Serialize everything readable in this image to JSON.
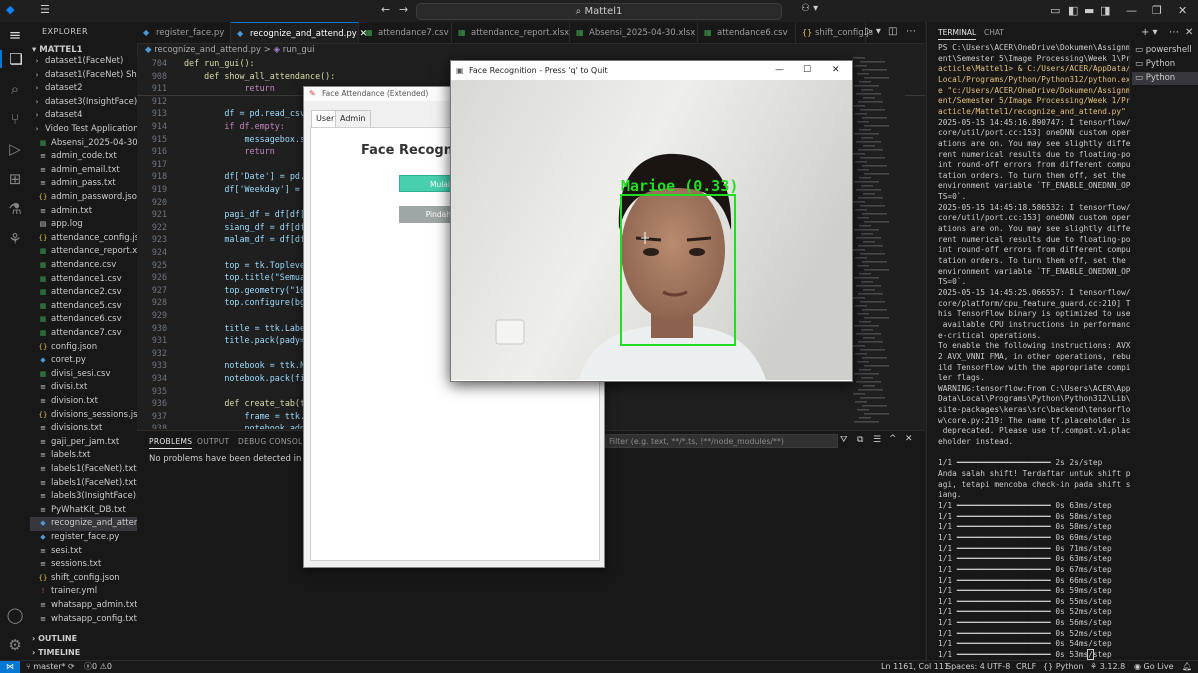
{
  "window": {
    "menu_icon": "vscode-icon",
    "search_text": "Mattel1",
    "nav_back": "←",
    "nav_forward": "→"
  },
  "explorer": {
    "header": "EXPLORER",
    "root": "MATTEL1",
    "items": [
      {
        "label": "dataset1(FaceNet)",
        "type": "folder"
      },
      {
        "label": "dataset1(FaceNet) Shift",
        "type": "folder"
      },
      {
        "label": "dataset2",
        "type": "folder"
      },
      {
        "label": "dataset3(InsightFace)",
        "type": "folder"
      },
      {
        "label": "dataset4",
        "type": "folder"
      },
      {
        "label": "Video Test Application",
        "type": "folder"
      },
      {
        "label": "Absensi_2025-04-30.x...",
        "type": "xlsx"
      },
      {
        "label": "admin_code.txt",
        "type": "txt"
      },
      {
        "label": "admin_email.txt",
        "type": "txt"
      },
      {
        "label": "admin_pass.txt",
        "type": "txt"
      },
      {
        "label": "admin_password.json",
        "type": "json"
      },
      {
        "label": "admin.txt",
        "type": "txt"
      },
      {
        "label": "app.log",
        "type": "log"
      },
      {
        "label": "attendance_config.json",
        "type": "json"
      },
      {
        "label": "attendance_report.xlsx",
        "type": "xlsx"
      },
      {
        "label": "attendance.csv",
        "type": "csv"
      },
      {
        "label": "attendance1.csv",
        "type": "csv"
      },
      {
        "label": "attendance2.csv",
        "type": "csv"
      },
      {
        "label": "attendance5.csv",
        "type": "csv"
      },
      {
        "label": "attendance6.csv",
        "type": "csv"
      },
      {
        "label": "attendance7.csv",
        "type": "csv"
      },
      {
        "label": "config.json",
        "type": "json"
      },
      {
        "label": "coret.py",
        "type": "py"
      },
      {
        "label": "divisi_sesi.csv",
        "type": "csv"
      },
      {
        "label": "divisi.txt",
        "type": "txt"
      },
      {
        "label": "division.txt",
        "type": "txt"
      },
      {
        "label": "divisions_sessions.json",
        "type": "json"
      },
      {
        "label": "divisions.txt",
        "type": "txt"
      },
      {
        "label": "gaji_per_jam.txt",
        "type": "txt"
      },
      {
        "label": "labels.txt",
        "type": "txt"
      },
      {
        "label": "labels1(FaceNet).txt",
        "type": "txt"
      },
      {
        "label": "labels1(FaceNet).txt",
        "type": "txt"
      },
      {
        "label": "labels3(InsightFace).txt",
        "type": "txt"
      },
      {
        "label": "PyWhatKit_DB.txt",
        "type": "txt"
      },
      {
        "label": "recognize_and_attend...",
        "type": "py",
        "selected": true
      },
      {
        "label": "register_face.py",
        "type": "py"
      },
      {
        "label": "sesi.txt",
        "type": "txt"
      },
      {
        "label": "sessions.txt",
        "type": "txt"
      },
      {
        "label": "shift_config.json",
        "type": "json"
      },
      {
        "label": "trainer.yml",
        "type": "yml"
      },
      {
        "label": "whatsapp_admin.txt",
        "type": "txt"
      },
      {
        "label": "whatsapp_config.txt",
        "type": "txt"
      }
    ],
    "outline": "OUTLINE",
    "timeline": "TIMELINE"
  },
  "tabs": [
    {
      "label": "register_face.py",
      "type": "py"
    },
    {
      "label": "recognize_and_attend.py",
      "type": "py",
      "active": true
    },
    {
      "label": "attendance7.csv",
      "type": "csv"
    },
    {
      "label": "attendance_report.xlsx",
      "type": "xlsx"
    },
    {
      "label": "Absensi_2025-04-30.xlsx",
      "type": "xlsx"
    },
    {
      "label": "attendance6.csv",
      "type": "csv"
    },
    {
      "label": "shift_config.js",
      "type": "json"
    }
  ],
  "breadcrumb": {
    "file": "recognize_and_attend.py",
    "sep": ">",
    "symbol": "run_gui"
  },
  "editor": {
    "sticky": [
      {
        "ln": "704",
        "code": "def run_gui():"
      },
      {
        "ln": "908",
        "code": "    def show_all_attendance():"
      },
      {
        "ln": "911",
        "code": "            return"
      }
    ],
    "lines": [
      {
        "ln": "912",
        "code": ""
      },
      {
        "ln": "913",
        "code": "        df = pd.read_csv("
      },
      {
        "ln": "914",
        "code": "        if df.empty:"
      },
      {
        "ln": "915",
        "code": "            messagebox.sh"
      },
      {
        "ln": "916",
        "code": "            return"
      },
      {
        "ln": "917",
        "code": ""
      },
      {
        "ln": "918",
        "code": "        df['Date'] = pd.t"
      },
      {
        "ln": "919",
        "code": "        df['Weekday'] = p"
      },
      {
        "ln": "920",
        "code": ""
      },
      {
        "ln": "921",
        "code": "        pagi_df = df[df['"
      },
      {
        "ln": "922",
        "code": "        siang_df = df[df["
      },
      {
        "ln": "923",
        "code": "        malam_df = df[df["
      },
      {
        "ln": "924",
        "code": ""
      },
      {
        "ln": "925",
        "code": "        top = tk.Topleve"
      },
      {
        "ln": "926",
        "code": "        top.title(\"Semua"
      },
      {
        "ln": "927",
        "code": "        top.geometry(\"100"
      },
      {
        "ln": "928",
        "code": "        top.configure(bg="
      },
      {
        "ln": "929",
        "code": ""
      },
      {
        "ln": "930",
        "code": "        title = ttk.Label"
      },
      {
        "ln": "931",
        "code": "        title.pack(pady=1"
      },
      {
        "ln": "932",
        "code": ""
      },
      {
        "ln": "933",
        "code": "        notebook = ttk.Nc"
      },
      {
        "ln": "934",
        "code": "        notebook.pack(fil"
      },
      {
        "ln": "935",
        "code": ""
      },
      {
        "ln": "936",
        "code": "        def create_tab(ti"
      },
      {
        "ln": "937",
        "code": "            frame = ttk.F"
      },
      {
        "ln": "938",
        "code": "            notebook.add("
      },
      {
        "ln": "939",
        "code": ""
      },
      {
        "ln": "940",
        "code": "            tree = ttk.Tr"
      }
    ]
  },
  "panel": {
    "tabs": [
      "PROBLEMS",
      "OUTPUT",
      "DEBUG CONSOLE"
    ],
    "message": "No problems have been detected in the wo",
    "filter_placeholder": "Filter (e.g. text, **/*.ts, !**/node_modules/**)"
  },
  "terminal": {
    "tabs": [
      "TERMINAL",
      "CHAT"
    ],
    "sessions": [
      "powershell",
      "Python",
      "Python"
    ],
    "lines": [
      "PS C:\\Users\\ACER\\OneDrive\\Dokumen\\Assignm",
      "ent\\Semester 5\\Image Processing\\Week 1\\Pr",
      "acticle\\Mattel1> & C:/Users/ACER/AppData/",
      "Local/Programs/Python/Python312/python.ex",
      "e \"c:/Users/ACER/OneDrive/Dokumen/Assignm",
      "ent/Semester 5/Image Processing/Week 1/Pr",
      "acticle/Mattel1/recognize_and_attend.py\"",
      "2025-05-15 14:45:16.890747: I tensorflow/",
      "core/util/port.cc:153] oneDNN custom oper",
      "ations are on. You may see slightly diffe",
      "rent numerical results due to floating-po",
      "int round-off errors from different compu",
      "tation orders. To turn them off, set the",
      "environment variable `TF_ENABLE_ONEDNN_OP",
      "TS=0`.",
      "2025-05-15 14:45:18.586532: I tensorflow/",
      "core/util/port.cc:153] oneDNN custom oper",
      "ations are on. You may see slightly diffe",
      "rent numerical results due to floating-po",
      "int round-off errors from different compu",
      "tation orders. To turn them off, set the",
      "environment variable `TF_ENABLE_ONEDNN_OP",
      "TS=0`.",
      "2025-05-15 14:45:25.066557: I tensorflow/",
      "core/platform/cpu_feature_guard.cc:210] T",
      "his TensorFlow binary is optimized to use",
      " available CPU instructions in performanc",
      "e-critical operations.",
      "To enable the following instructions: AVX",
      "2 AVX_VNNI FMA, in other operations, rebu",
      "ild TensorFlow with the appropriate compi",
      "ler flags.",
      "WARNING:tensorflow:From C:\\Users\\ACER\\App",
      "Data\\Local\\Programs\\Python\\Python312\\Lib\\",
      "site-packages\\keras\\src\\backend\\tensorflo",
      "w\\core.py:219: The name tf.placeholder is",
      " deprecated. Please use tf.compat.v1.plac",
      "eholder instead.",
      "",
      "1/1 ━━━━━━━━━━━━━━━━━━━━ 2s 2s/step",
      "Anda salah shift! Terdaftar untuk shift p",
      "agi, tetapi mencoba check-in pada shift s",
      "iang.",
      "1/1 ━━━━━━━━━━━━━━━━━━━━ 0s 63ms/step",
      "1/1 ━━━━━━━━━━━━━━━━━━━━ 0s 58ms/step",
      "1/1 ━━━━━━━━━━━━━━━━━━━━ 0s 58ms/step",
      "1/1 ━━━━━━━━━━━━━━━━━━━━ 0s 69ms/step",
      "1/1 ━━━━━━━━━━━━━━━━━━━━ 0s 71ms/step",
      "1/1 ━━━━━━━━━━━━━━━━━━━━ 0s 63ms/step",
      "1/1 ━━━━━━━━━━━━━━━━━━━━ 0s 67ms/step",
      "1/1 ━━━━━━━━━━━━━━━━━━━━ 0s 66ms/step",
      "1/1 ━━━━━━━━━━━━━━━━━━━━ 0s 59ms/step",
      "1/1 ━━━━━━━━━━━━━━━━━━━━ 0s 55ms/step",
      "1/1 ━━━━━━━━━━━━━━━━━━━━ 0s 52ms/step",
      "1/1 ━━━━━━━━━━━━━━━━━━━━ 0s 56ms/step",
      "1/1 ━━━━━━━━━━━━━━━━━━━━ 0s 52ms/step",
      "1/1 ━━━━━━━━━━━━━━━━━━━━ 0s 54ms/step",
      "1/1 ━━━━━━━━━━━━━━━━━━━━ 0s 53ms/step",
      "1/1 ━━━━━━━━━━━━━━━━━━━━ 0s 41ms/step"
    ]
  },
  "tk_window": {
    "title": "Face Attendance (Extended)",
    "tabs": [
      "User",
      "Admin"
    ],
    "heading": "Face Recogniti",
    "button_start": "Mulai",
    "button_move": "Pindah"
  },
  "face_window": {
    "title": "Face Recognition - Press 'q' to Quit",
    "label": "Marioe (0.33)",
    "box_color": "#22dd22"
  },
  "statusbar": {
    "branch": "master*",
    "errors": "0",
    "warnings": "0",
    "position": "Ln 1161, Col 111",
    "spaces": "Spaces: 4",
    "encoding": "UTF-8",
    "eol": "CRLF",
    "language": "Python",
    "version": "3.12.8",
    "golive": "Go Live"
  },
  "colors": {
    "accent": "#0078d4",
    "tk_button_start": "#48cfae",
    "tk_button_move": "#9ea7a5"
  }
}
